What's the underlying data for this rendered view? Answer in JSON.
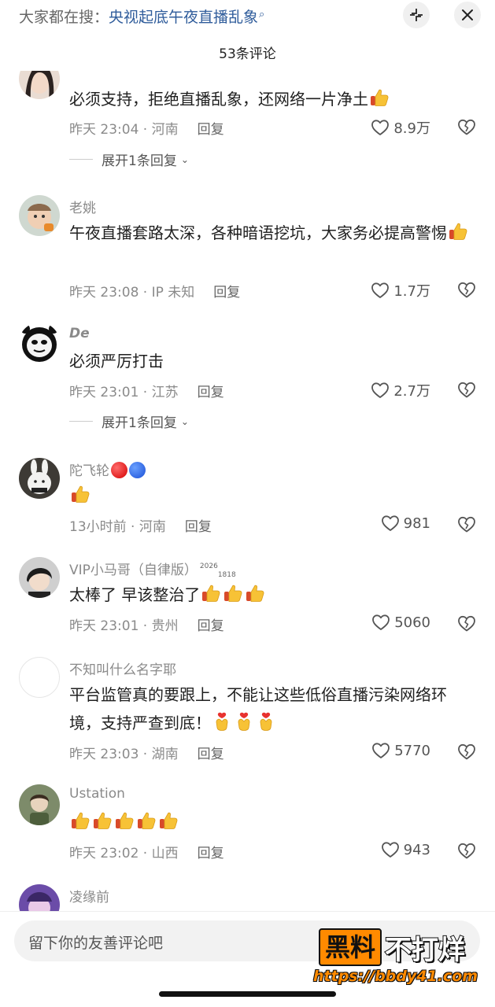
{
  "header": {
    "search_prefix": "大家都在搜：",
    "search_keyword": "央视起底午夜直播乱象",
    "comment_count": "53条评论"
  },
  "comments": [
    {
      "username": "",
      "text": "必须支持，拒绝直播乱象，还网络一片净土",
      "time_location": "昨天 23:04 · 河南",
      "reply_label": "回复",
      "likes": "8.9万",
      "expand_label": "展开1条回复"
    },
    {
      "username": "老姚",
      "text": "午夜直播套路太深，各种暗语挖坑，大家务必提高警惕",
      "time_location": "昨天 23:08 · IP 未知",
      "reply_label": "回复",
      "likes": "1.7万"
    },
    {
      "username": "De",
      "text": "必须严厉打击",
      "time_location": "昨天 23:01 · 江苏",
      "reply_label": "回复",
      "likes": "2.7万",
      "expand_label": "展开1条回复"
    },
    {
      "username": "陀飞轮",
      "text": "",
      "time_location": "13小时前 · 河南",
      "reply_label": "回复",
      "likes": "981"
    },
    {
      "username": "VIP小马哥（自律版）",
      "user_sup": "2026",
      "user_sub": "1818",
      "text": "太棒了 早该整治了",
      "time_location": "昨天 23:01 · 贵州",
      "reply_label": "回复",
      "likes": "5060"
    },
    {
      "username": "不知叫什么名字耶",
      "text": "平台监管真的要跟上，不能让这些低俗直播污染网络环境，支持严查到底！",
      "time_location": "昨天 23:03 · 湖南",
      "reply_label": "回复",
      "likes": "5770"
    },
    {
      "username": "Ustation",
      "text": "",
      "time_location": "昨天 23:02 · 山西",
      "reply_label": "回复",
      "likes": "943"
    },
    {
      "username": "凌缘前"
    }
  ],
  "input": {
    "placeholder": "留下你的友善评论吧"
  },
  "watermark": {
    "brand_black": "黑料",
    "brand_rest": "不打烊",
    "url": "https://bbdy41.com"
  },
  "colors": {
    "keyword": "#2f5c9b",
    "meta_gray": "#8a8a8a",
    "red_dot": "#d40000",
    "blue_dot": "#1a4fd6",
    "watermark_orange": "#ff8a00"
  },
  "icons": [
    "collapse-icon",
    "close-icon",
    "search-icon",
    "heart-icon",
    "broken-heart-icon",
    "chevron-down-icon",
    "thumbs-up-emoji",
    "finger-heart-emoji"
  ]
}
